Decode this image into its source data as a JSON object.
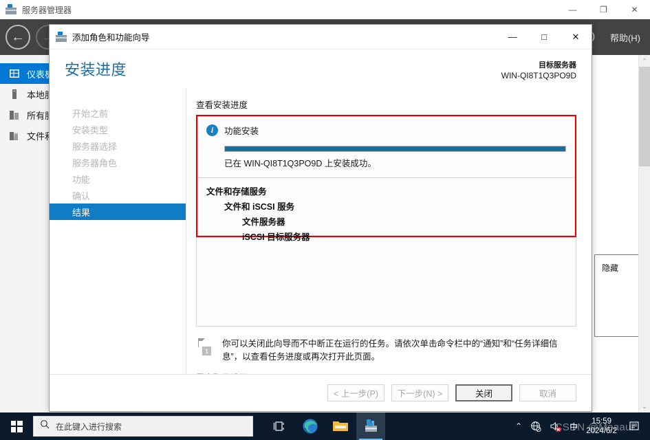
{
  "server_manager": {
    "title": "服务器管理器",
    "title_icon": "toolbox-icon",
    "window_controls": {
      "minimize": "—",
      "restore": "❐",
      "close": "✕"
    },
    "nav_back": "←",
    "nav_forward": "→",
    "menu": [
      "V)",
      "帮助(H)"
    ],
    "sidebar": [
      {
        "label": "仪表板",
        "icon": "dashboard-icon",
        "active": true
      },
      {
        "label": "本地服",
        "icon": "server-icon",
        "active": false
      },
      {
        "label": "所有服",
        "icon": "servers-icon",
        "active": false
      },
      {
        "label": "文件和",
        "icon": "file-storage-icon",
        "active": false
      }
    ],
    "hide_button": "隐藏",
    "scroll_up": "⌃",
    "scroll_down": "⌄"
  },
  "wizard": {
    "title": "添加角色和功能向导",
    "title_icon": "toolbox-icon",
    "window_controls": {
      "minimize": "—",
      "maximize": "□",
      "close": "✕"
    },
    "page_title": "安装进度",
    "target_server": {
      "label": "目标服务器",
      "name": "WIN-QI8T1Q3PO9D"
    },
    "steps": [
      {
        "label": "开始之前",
        "state": "done"
      },
      {
        "label": "安装类型",
        "state": "done"
      },
      {
        "label": "服务器选择",
        "state": "done"
      },
      {
        "label": "服务器角色",
        "state": "done"
      },
      {
        "label": "功能",
        "state": "done"
      },
      {
        "label": "确认",
        "state": "done"
      },
      {
        "label": "结果",
        "state": "current"
      }
    ],
    "content_label": "查看安装进度",
    "feature_section": {
      "icon": "info-icon",
      "heading": "功能安装",
      "progress_percent": 100,
      "progress_color": "#13719b",
      "status_message": "已在 WIN-QI8T1Q3PO9D 上安装成功。"
    },
    "installed_tree": [
      {
        "label": "文件和存储服务",
        "level": 0
      },
      {
        "label": "文件和 iSCSI 服务",
        "level": 1
      },
      {
        "label": "文件服务器",
        "level": 2
      },
      {
        "label": "iSCSI 目标服务器",
        "level": 2
      }
    ],
    "highlight_color": "#e60000",
    "note": {
      "icon": "flag-icon",
      "badge": "1",
      "text": "你可以关闭此向导而不中断正在运行的任务。请依次单击命令栏中的“通知”和“任务详细信息”，以查看任务进度或再次打开此页面。"
    },
    "export_link": "导出配置设置",
    "buttons": [
      {
        "label": "< 上一步(P)",
        "state": "disabled"
      },
      {
        "label": "下一步(N) >",
        "state": "disabled"
      },
      {
        "label": "关闭",
        "state": "default"
      },
      {
        "label": "取消",
        "state": "disabled"
      }
    ]
  },
  "taskbar": {
    "start_icon": "windows-logo-icon",
    "search_placeholder": "在此键入进行搜索",
    "search_icon": "search-icon",
    "pinned": [
      {
        "name": "task-view-icon",
        "active": false
      },
      {
        "name": "edge-icon",
        "active": false
      },
      {
        "name": "file-explorer-icon",
        "active": false
      },
      {
        "name": "server-manager-icon",
        "active": true
      }
    ],
    "tray": {
      "chevron": "⌃",
      "network_icon": "network-disconnected-icon",
      "volume_icon": "volume-muted-icon",
      "ime": "中"
    },
    "clock": {
      "time": "15:59",
      "date": "2024/6/2"
    },
    "action_center_icon": "notifications-icon"
  },
  "watermark": "CSDN @Meaaur"
}
